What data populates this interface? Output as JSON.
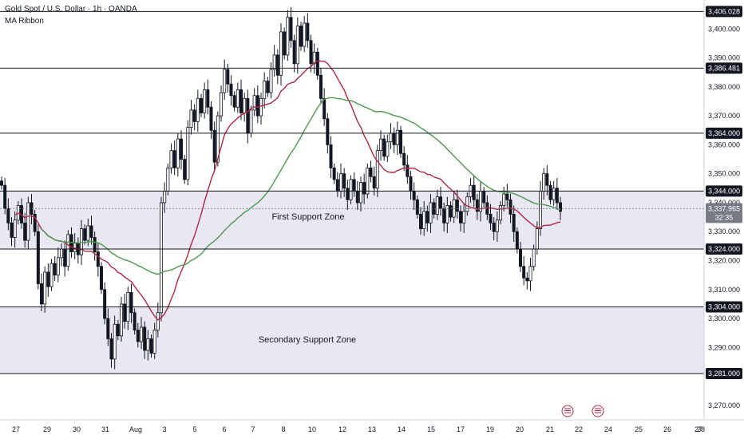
{
  "header": {
    "title": "Gold Spot / U.S. Dollar · 1h · OANDA",
    "indicator": "MA Ribbon"
  },
  "colors": {
    "background": "#ffffff",
    "candle": "#131722",
    "ma_fast": "#b2263f",
    "ma_slow": "#4c9a4c",
    "zone_fill": "#b8b4d6",
    "level_line": "#131722",
    "price_tag_bg": "#131722",
    "current_tag_bg": "#787b86"
  },
  "chart_data": {
    "type": "candlestick",
    "title": "Gold Spot / U.S. Dollar · 1h · OANDA",
    "ylim": [
      3265,
      3410
    ],
    "y_ticks": [
      "3,400.000",
      "3,390.000",
      "3,380.000",
      "3,370.000",
      "3,360.000",
      "3,350.000",
      "3,340.000",
      "3,330.000",
      "3,320.000",
      "3,310.000",
      "3,300.000",
      "3,290.000",
      "3,270.000"
    ],
    "y_tick_values": [
      3400,
      3390,
      3380,
      3370,
      3360,
      3350,
      3340,
      3330,
      3320,
      3310,
      3300,
      3290,
      3270
    ],
    "x_ticks": [
      "27",
      "29",
      "30",
      "31",
      "Aug",
      "3",
      "5",
      "6",
      "7",
      "8",
      "10",
      "12",
      "13",
      "14",
      "15",
      "17",
      "19",
      "20",
      "21",
      "22",
      "24",
      "25",
      "26",
      "27",
      "28"
    ],
    "levels": [
      {
        "value": 3406.028,
        "label": "3,406.028"
      },
      {
        "value": 3386.481,
        "label": "3,386.481"
      },
      {
        "value": 3364.0,
        "label": "3,364.000"
      },
      {
        "value": 3344.0,
        "label": "3,344.000"
      },
      {
        "value": 3324.0,
        "label": "3,324.000"
      },
      {
        "value": 3304.0,
        "label": "3,304.000"
      },
      {
        "value": 3281.0,
        "label": "3,281.000"
      }
    ],
    "zones": [
      {
        "name": "First Support Zone",
        "from": 3324,
        "to": 3344
      },
      {
        "name": "Secondary Support Zone",
        "from": 3281,
        "to": 3304
      }
    ],
    "current_price": {
      "value": 3337.965,
      "label": "3,337.965",
      "countdown": "32:35"
    },
    "series": [
      {
        "name": "price",
        "points": [
          3346,
          3338,
          3333,
          3328,
          3334,
          3339,
          3333,
          3327,
          3340,
          3336,
          3330,
          3312,
          3305,
          3316,
          3311,
          3319,
          3315,
          3321,
          3324,
          3318,
          3329,
          3323,
          3326,
          3322,
          3331,
          3327,
          3332,
          3328,
          3323,
          3318,
          3310,
          3300,
          3293,
          3286,
          3298,
          3294,
          3305,
          3299,
          3309,
          3302,
          3296,
          3292,
          3297,
          3289,
          3293,
          3288,
          3296,
          3302,
          3340,
          3344,
          3352,
          3358,
          3352,
          3362,
          3355,
          3348,
          3366,
          3372,
          3368,
          3376,
          3371,
          3379,
          3373,
          3365,
          3354,
          3370,
          3378,
          3386,
          3381,
          3377,
          3373,
          3379,
          3371,
          3376,
          3364,
          3372,
          3377,
          3370,
          3376,
          3382,
          3378,
          3386,
          3391,
          3384,
          3399,
          3391,
          3404,
          3396,
          3388,
          3401,
          3394,
          3402,
          3396,
          3388,
          3392,
          3384,
          3376,
          3369,
          3360,
          3352,
          3348,
          3344,
          3350,
          3345,
          3341,
          3348,
          3344,
          3340,
          3347,
          3343,
          3352,
          3349,
          3345,
          3358,
          3362,
          3356,
          3361,
          3364,
          3360,
          3365,
          3357,
          3353,
          3349,
          3344,
          3341,
          3336,
          3331,
          3337,
          3333,
          3340,
          3336,
          3342,
          3338,
          3333,
          3339,
          3335,
          3341,
          3337,
          3333,
          3337,
          3342,
          3346,
          3341,
          3337,
          3344,
          3340,
          3336,
          3333,
          3330,
          3334,
          3339,
          3343,
          3341,
          3336,
          3330,
          3324,
          3318,
          3314,
          3313,
          3318,
          3324,
          3331,
          3344,
          3350,
          3346,
          3341,
          3345,
          3340,
          3337
        ]
      }
    ]
  },
  "labels": {
    "zone_primary": "First Support Zone",
    "zone_secondary": "Secondary Support Zone"
  }
}
